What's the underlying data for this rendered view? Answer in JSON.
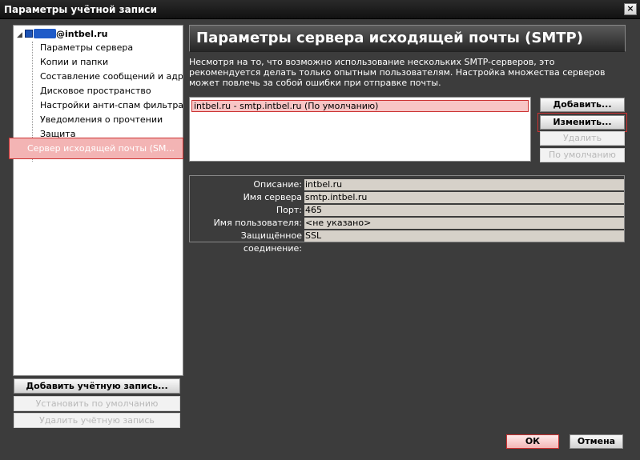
{
  "window": {
    "title": "Параметры учётной записи",
    "close_glyph": "×"
  },
  "tree": {
    "account": "@intbel.ru",
    "items": [
      "Параметры сервера",
      "Копии и папки",
      "Составление сообщений и адр...",
      "Дисковое пространство",
      "Настройки анти-спам фильтра",
      "Уведомления о прочтении",
      "Защита"
    ],
    "selected": "Сервер исходящей почты (SM..."
  },
  "left_buttons": {
    "add_account": "Добавить учётную запись...",
    "set_default": "Установить по умолчанию",
    "remove_account": "Удалить учётную запись"
  },
  "panel": {
    "title": "Параметры сервера исходящей почты (SMTP)",
    "description": "Несмотря на то, что возможно использование нескольких SMTP-серверов, это рекомендуется делать только опытным пользователям. Настройка множества серверов может повлечь за собой ошибки при отправке почты."
  },
  "servers": [
    "intbel.ru - smtp.intbel.ru (По умолчанию)"
  ],
  "server_buttons": {
    "add": "Добавить...",
    "edit": "Изменить...",
    "remove": "Удалить",
    "default": "По умолчанию"
  },
  "details": [
    {
      "label": "Описание:",
      "value": "intbel.ru"
    },
    {
      "label": "Имя сервера",
      "value": "smtp.intbel.ru"
    },
    {
      "label": "Порт:",
      "value": "465"
    },
    {
      "label": "Имя пользователя:",
      "value": "<не указано>"
    },
    {
      "label": "Защищённое соединение:",
      "value": "SSL"
    }
  ],
  "dialog_buttons": {
    "ok": "ОК",
    "cancel": "Отмена"
  },
  "colors": {
    "background": "#3c3c3c",
    "selection": "#f3b4b4",
    "selection_border": "#cc3232"
  }
}
